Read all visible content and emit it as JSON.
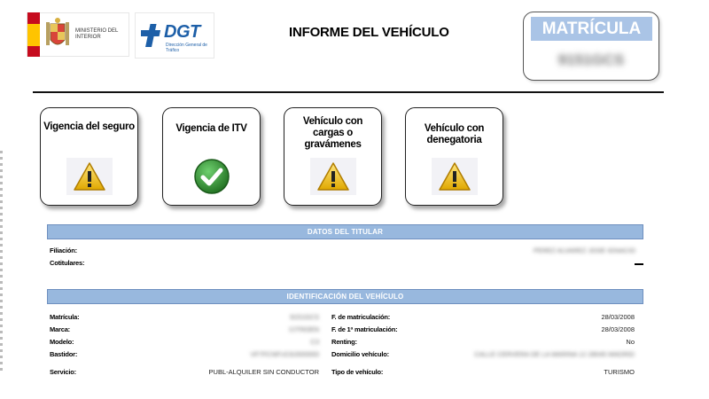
{
  "header": {
    "ministry_label": "MINISTERIO DEL INTERIOR",
    "dgt_name": "DGT",
    "dgt_subtitle": "Dirección General de Tráfico",
    "title": "INFORME DEL VEHÍCULO",
    "plate_label": "MATRÍCULA",
    "plate_value": "9151GCS"
  },
  "cards": [
    {
      "title": "Vigencia del seguro",
      "status": "warning",
      "icon": "warning-icon"
    },
    {
      "title": "Vigencia de ITV",
      "status": "ok",
      "icon": "check-icon"
    },
    {
      "title": "Vehículo con cargas o gravámenes",
      "status": "warning",
      "icon": "warning-icon"
    },
    {
      "title": "Vehículo con denegatoria",
      "status": "warning",
      "icon": "warning-icon"
    }
  ],
  "owner_section": {
    "title": "DATOS DEL TITULAR",
    "filiacion_label": "Filiación:",
    "filiacion_value": "PEREZ ALVAREZ JOSE IGNACIO",
    "cotitulares_label": "Cotitulares:",
    "cotitulares_value": "—"
  },
  "vehicle_section": {
    "title": "IDENTIFICACIÓN DEL VEHÍCULO",
    "left": [
      {
        "label": "Matrícula:",
        "value": "9151GCS",
        "blurred": true
      },
      {
        "label": "Marca:",
        "value": "CITROEN",
        "blurred": true
      },
      {
        "label": "Modelo:",
        "value": "C3",
        "blurred": true
      },
      {
        "label": "Bastidor:",
        "value": "VF7FCNFUC8J000000",
        "blurred": true
      },
      {
        "label": "Servicio:",
        "value": "PUBL-ALQUILER SIN CONDUCTOR",
        "blurred": false
      }
    ],
    "right": [
      {
        "label": "F. de matriculación:",
        "value": "28/03/2008",
        "blurred": false
      },
      {
        "label": "F. de 1ª matriculación:",
        "value": "28/03/2008",
        "blurred": false
      },
      {
        "label": "Renting:",
        "value": "No",
        "blurred": false
      },
      {
        "label": "Domicilio vehículo:",
        "value": "CALLE CERVERA DE LA MARINA 12 28045 MADRID",
        "blurred": true
      },
      {
        "label": "Tipo de vehículo:",
        "value": "TURISMO",
        "blurred": false
      }
    ]
  },
  "colors": {
    "section_bar": "#98b8de",
    "plate_label_bg": "#aac4e6",
    "dgt_blue": "#1d5fa8",
    "warning_yellow": "#f2c200",
    "ok_green": "#2e8b2e"
  }
}
